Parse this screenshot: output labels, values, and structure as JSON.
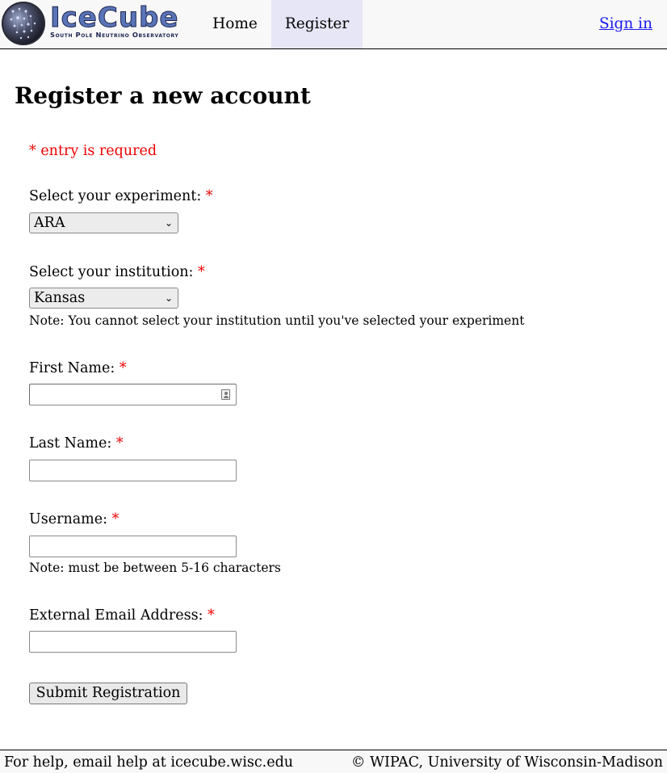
{
  "header": {
    "logo_word": "IceCube",
    "logo_tagline": "South Pole Neutrino Observatory",
    "nav": {
      "home": "Home",
      "register": "Register"
    },
    "sign_in": "Sign in"
  },
  "page_title": "Register a new account",
  "required_note": "* entry is requred",
  "form": {
    "experiment": {
      "label": "Select your experiment:",
      "star": "*",
      "selected": "ARA"
    },
    "institution": {
      "label": "Select your institution:",
      "star": "*",
      "selected": "Kansas",
      "note": "Note: You cannot select your institution until you've selected your experiment"
    },
    "first_name": {
      "label": "First Name:",
      "star": "*",
      "value": ""
    },
    "last_name": {
      "label": "Last Name:",
      "star": "*",
      "value": ""
    },
    "username": {
      "label": "Username:",
      "star": "*",
      "value": "",
      "note": "Note: must be between 5-16 characters"
    },
    "email": {
      "label": "External Email Address:",
      "star": "*",
      "value": ""
    },
    "submit_label": "Submit Registration"
  },
  "footer": {
    "help": "For help, email help at icecube.wisc.edu",
    "copyright": "© WIPAC, University of Wisconsin-Madison"
  },
  "colors": {
    "required": "#ee0000",
    "link": "#1a1aee",
    "active_nav": "#e6e6f7",
    "logo_blue": "#5a74b8"
  }
}
